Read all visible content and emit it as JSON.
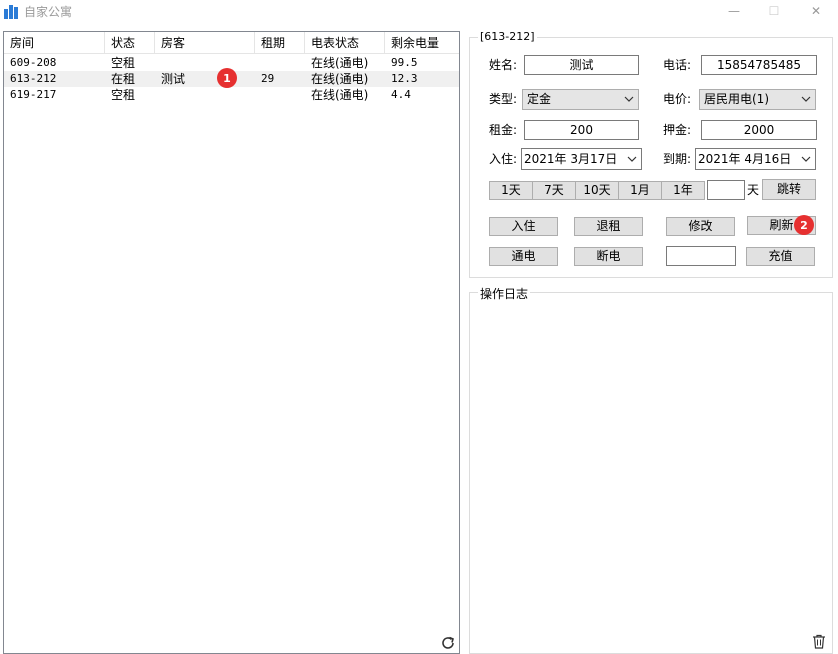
{
  "window": {
    "title": "自家公寓",
    "minimize_glyph": "—",
    "maximize_glyph": "☐",
    "close_glyph": "✕",
    "icon": "building-icon"
  },
  "list": {
    "columns": [
      "房间",
      "状态",
      "房客",
      "租期",
      "电表状态",
      "剩余电量"
    ],
    "rows": [
      {
        "room": "609-208",
        "status": "空租",
        "tenant": "",
        "term": "",
        "meter": "在线(通电)",
        "power": "99.5"
      },
      {
        "room": "613-212",
        "status": "在租",
        "tenant": "测试",
        "term": "29",
        "meter": "在线(通电)",
        "power": "12.3"
      },
      {
        "room": "619-217",
        "status": "空租",
        "tenant": "",
        "term": "",
        "meter": "在线(通电)",
        "power": "4.4"
      }
    ],
    "selected_row": 1,
    "refresh_icon": "refresh-icon"
  },
  "badges": {
    "one": "1",
    "two": "2"
  },
  "detail": {
    "group_title": "[613-212]",
    "name_label": "姓名:",
    "name_value": "测试",
    "phone_label": "电话:",
    "phone_value": "15854785485",
    "type_label": "类型:",
    "type_value": "定金",
    "price_label": "电价:",
    "price_value": "居民用电(1)",
    "rent_label": "租金:",
    "rent_value": "200",
    "deposit_label": "押金:",
    "deposit_value": "2000",
    "checkin_label": "入住:",
    "checkin_value": "2021年  3月17日",
    "expire_label": "到期:",
    "expire_value": "2021年  4月16日",
    "quick_buttons": [
      "1天",
      "7天",
      "10天",
      "1月",
      "1年"
    ],
    "days_input": "",
    "days_unit": "天",
    "jump_label": "跳转",
    "checkin_btn": "入住",
    "checkout_btn": "退租",
    "modify_btn": "修改",
    "refresh_btn": "刷新",
    "power_on_btn": "通电",
    "power_off_btn": "断电",
    "recharge_input": "",
    "recharge_btn": "充值"
  },
  "log": {
    "group_title": "操作日志",
    "trash_icon": "trash-icon"
  }
}
